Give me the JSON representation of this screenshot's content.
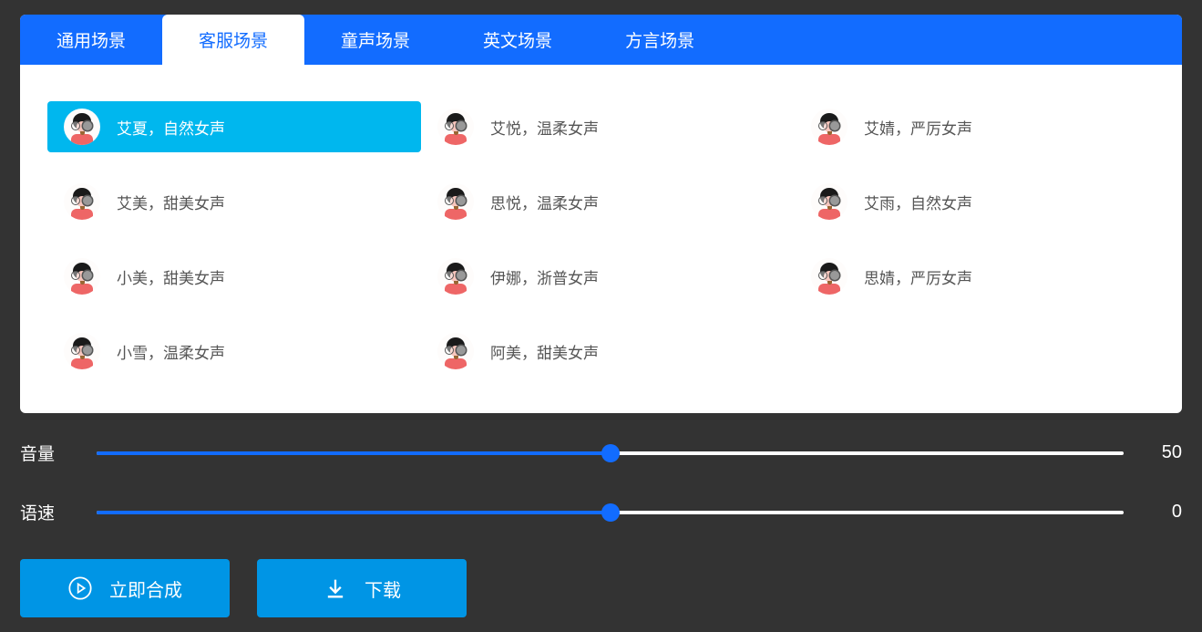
{
  "tabs": [
    {
      "label": "通用场景",
      "active": false
    },
    {
      "label": "客服场景",
      "active": true
    },
    {
      "label": "童声场景",
      "active": false
    },
    {
      "label": "英文场景",
      "active": false
    },
    {
      "label": "方言场景",
      "active": false
    }
  ],
  "voices": [
    {
      "label": "艾夏，自然女声",
      "selected": true
    },
    {
      "label": "艾悦，温柔女声",
      "selected": false
    },
    {
      "label": "艾婧，严厉女声",
      "selected": false
    },
    {
      "label": "艾美，甜美女声",
      "selected": false
    },
    {
      "label": "思悦，温柔女声",
      "selected": false
    },
    {
      "label": "艾雨，自然女声",
      "selected": false
    },
    {
      "label": "小美，甜美女声",
      "selected": false
    },
    {
      "label": "伊娜，浙普女声",
      "selected": false
    },
    {
      "label": "思婧，严厉女声",
      "selected": false
    },
    {
      "label": "小雪，温柔女声",
      "selected": false
    },
    {
      "label": "阿美，甜美女声",
      "selected": false
    }
  ],
  "sliders": {
    "volume": {
      "label": "音量",
      "value": "50",
      "percent": 50
    },
    "speed": {
      "label": "语速",
      "value": "0",
      "percent": 50
    }
  },
  "buttons": {
    "synth": "立即合成",
    "download": "下载"
  }
}
